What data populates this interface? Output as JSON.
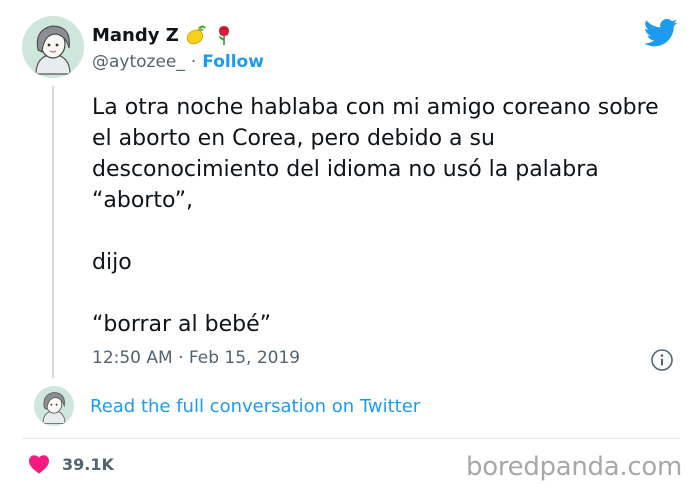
{
  "author": {
    "display_name": "Mandy Z",
    "handle": "@aytozee_",
    "separator": "·",
    "follow_label": "Follow"
  },
  "tweet": {
    "paragraphs": [
      "La otra noche hablaba con mi amigo coreano sobre el aborto en Corea, pero debido a su desconocimiento del idioma no usó la palabra “aborto”,",
      "dijo",
      "“borrar al bebé”"
    ],
    "timestamp": "12:50 AM · Feb 15, 2019"
  },
  "conversation_link": "Read the full conversation on Twitter",
  "likes": {
    "count": "39.1K"
  },
  "watermark": "boredpanda.com",
  "colors": {
    "accent": "#1d9bf0",
    "text": "#0f1419",
    "muted": "#536471",
    "heart": "#f91880",
    "watermark": "#a8a8a8"
  },
  "icons": {
    "logo": "twitter-bird-icon",
    "emoji_1": "lemon-emoji-icon",
    "emoji_2": "rose-emoji-icon",
    "info": "info-icon",
    "like": "heart-icon"
  }
}
